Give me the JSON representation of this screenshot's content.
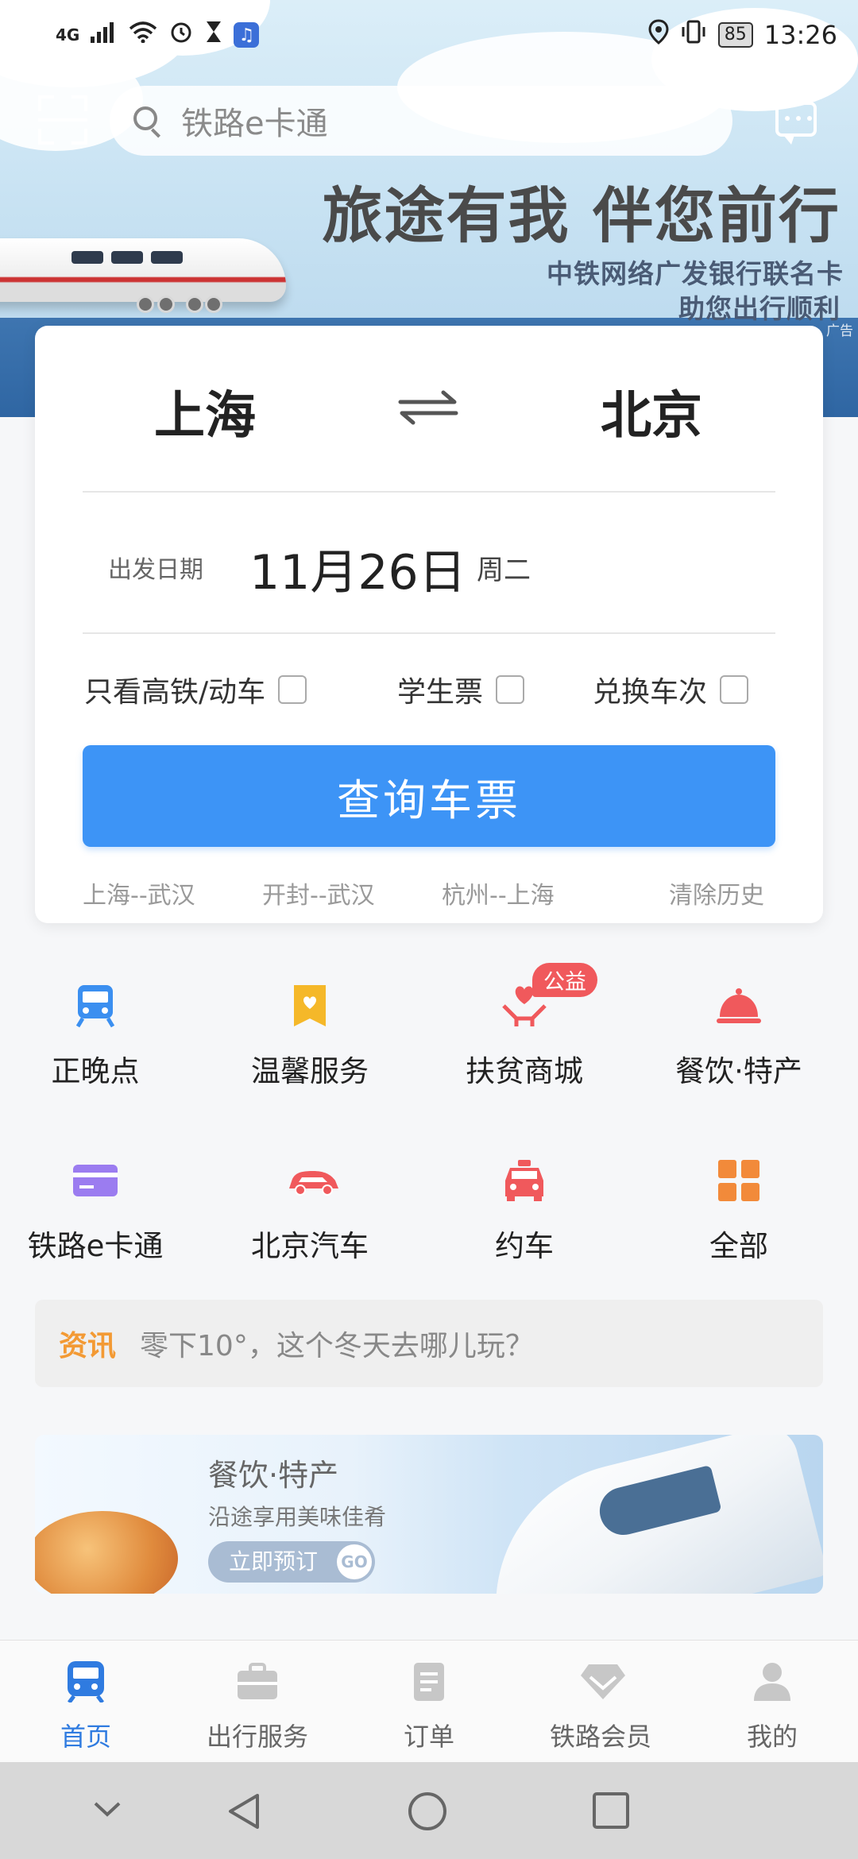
{
  "status_bar": {
    "network": "4G",
    "battery": "85",
    "time": "13:26"
  },
  "header": {
    "search_placeholder": "铁路e卡通"
  },
  "banner": {
    "slogan": "旅途有我 伴您前行",
    "sub_line1": "中铁网络广发银行联名卡",
    "sub_line2": "助您出行顺利",
    "ad_tag": "广告"
  },
  "booking": {
    "from_city": "上海",
    "to_city": "北京",
    "date_label": "出发日期",
    "date_value": "11月26日",
    "weekday": "周二",
    "options": [
      {
        "label": "只看高铁/动车"
      },
      {
        "label": "学生票"
      },
      {
        "label": "兑换车次"
      }
    ],
    "query_button": "查询车票",
    "history": [
      "上海--武汉",
      "开封--武汉",
      "杭州--上海"
    ],
    "clear_history": "清除历史"
  },
  "services": [
    {
      "label": "正晚点",
      "icon": "train-icon",
      "color": "#3b8ff0"
    },
    {
      "label": "温馨服务",
      "icon": "ribbon-heart-icon",
      "color": "#f5b829"
    },
    {
      "label": "扶贫商城",
      "icon": "hands-heart-icon",
      "color": "#f0595c",
      "badge": "公益"
    },
    {
      "label": "餐饮·特产",
      "icon": "dining-bell-icon",
      "color": "#f0595c"
    },
    {
      "label": "铁路e卡通",
      "icon": "card-icon",
      "color": "#9b7cf0"
    },
    {
      "label": "北京汽车",
      "icon": "car-icon",
      "color": "#f0595c"
    },
    {
      "label": "约车",
      "icon": "taxi-icon",
      "color": "#f0595c"
    },
    {
      "label": "全部",
      "icon": "grid-icon",
      "color": "#f28a3a"
    }
  ],
  "news": {
    "tag": "资讯",
    "text": "零下10°，这个冬天去哪儿玩？"
  },
  "promo": {
    "title": "餐饮·特产",
    "subtitle": "沿途享用美味佳肴",
    "button": "立即预订",
    "go": "GO"
  },
  "bottom_nav": [
    {
      "label": "首页",
      "icon": "train-home-icon",
      "active": true
    },
    {
      "label": "出行服务",
      "icon": "briefcase-icon"
    },
    {
      "label": "订单",
      "icon": "order-icon"
    },
    {
      "label": "铁路会员",
      "icon": "diamond-icon"
    },
    {
      "label": "我的",
      "icon": "person-icon"
    }
  ],
  "colors": {
    "accent": "#3d94f6",
    "active_nav": "#2f7be0",
    "news_tag": "#f39a34"
  }
}
